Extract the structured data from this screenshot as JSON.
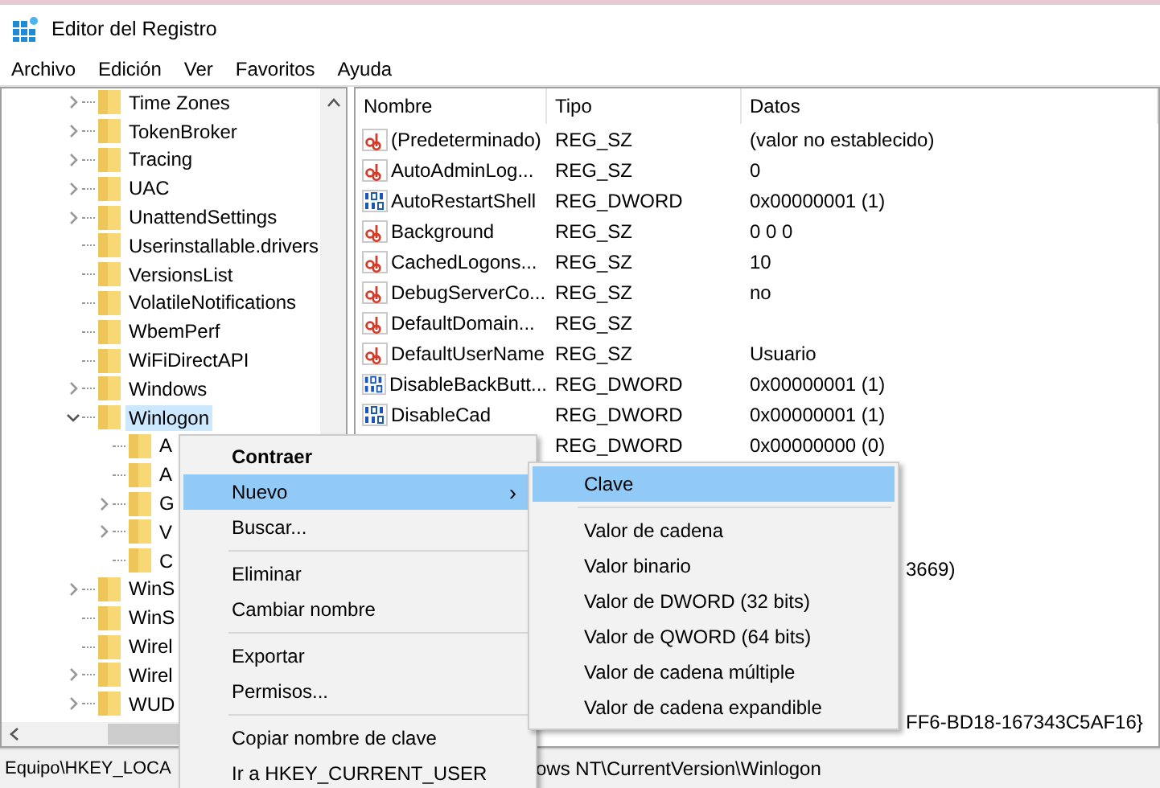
{
  "window": {
    "title": "Editor del Registro"
  },
  "menu_bar": [
    "Archivo",
    "Edición",
    "Ver",
    "Favoritos",
    "Ayuda"
  ],
  "tree": [
    {
      "label": "Time Zones",
      "expandable": true,
      "expanded": false,
      "selected": false
    },
    {
      "label": "TokenBroker",
      "expandable": true,
      "expanded": false,
      "selected": false
    },
    {
      "label": "Tracing",
      "expandable": true,
      "expanded": false,
      "selected": false
    },
    {
      "label": "UAC",
      "expandable": true,
      "expanded": false,
      "selected": false
    },
    {
      "label": "UnattendSettings",
      "expandable": true,
      "expanded": false,
      "selected": false
    },
    {
      "label": "Userinstallable.drivers",
      "expandable": false,
      "selected": false
    },
    {
      "label": "VersionsList",
      "expandable": false,
      "selected": false
    },
    {
      "label": "VolatileNotifications",
      "expandable": false,
      "selected": false
    },
    {
      "label": "WbemPerf",
      "expandable": false,
      "selected": false
    },
    {
      "label": "WiFiDirectAPI",
      "expandable": false,
      "selected": false
    },
    {
      "label": "Windows",
      "expandable": true,
      "expanded": false,
      "selected": false
    },
    {
      "label": "Winlogon",
      "expandable": true,
      "expanded": true,
      "selected": true,
      "children": [
        {
          "label": "A",
          "expandable": false,
          "selected": false
        },
        {
          "label": "A",
          "expandable": false,
          "selected": false
        },
        {
          "label": "G",
          "expandable": true,
          "expanded": false,
          "selected": false
        },
        {
          "label": "V",
          "expandable": true,
          "expanded": false,
          "selected": false
        },
        {
          "label": "C",
          "expandable": false,
          "selected": false
        }
      ]
    },
    {
      "label": "WinS",
      "expandable": true,
      "expanded": false,
      "selected": false
    },
    {
      "label": "WinS",
      "expandable": false,
      "selected": false
    },
    {
      "label": "Wirel",
      "expandable": false,
      "selected": false
    },
    {
      "label": "Wirel",
      "expandable": true,
      "expanded": false,
      "selected": false
    },
    {
      "label": "WUD",
      "expandable": true,
      "expanded": false,
      "selected": false
    }
  ],
  "list": {
    "columns": [
      "Nombre",
      "Tipo",
      "Datos"
    ],
    "rows": [
      {
        "kind": "sz",
        "name": "(Predeterminado)",
        "type": "REG_SZ",
        "data": "(valor no establecido)"
      },
      {
        "kind": "sz",
        "name": "AutoAdminLog...",
        "type": "REG_SZ",
        "data": "0"
      },
      {
        "kind": "dword",
        "name": "AutoRestartShell",
        "type": "REG_DWORD",
        "data": "0x00000001 (1)"
      },
      {
        "kind": "sz",
        "name": "Background",
        "type": "REG_SZ",
        "data": "0 0 0"
      },
      {
        "kind": "sz",
        "name": "CachedLogons...",
        "type": "REG_SZ",
        "data": "10"
      },
      {
        "kind": "sz",
        "name": "DebugServerCo...",
        "type": "REG_SZ",
        "data": "no"
      },
      {
        "kind": "sz",
        "name": "DefaultDomain...",
        "type": "REG_SZ"
      },
      {
        "kind": "sz",
        "name": "DefaultUserName",
        "type": "REG_SZ",
        "data": "Usuario"
      },
      {
        "kind": "dword",
        "name": "DisableBackButt...",
        "type": "REG_DWORD",
        "data": "0x00000001 (1)"
      },
      {
        "kind": "dword",
        "name": "DisableCad",
        "type": "REG_DWORD",
        "data": "0x00000001 (1)"
      },
      {
        "kind": "covered",
        "type": "REG_DWORD",
        "data": "0x00000000 (0)"
      },
      {
        "kind": "covered"
      },
      {
        "kind": "covered"
      },
      {
        "kind": "covered"
      },
      {
        "kind": "partial",
        "data": "3669)"
      },
      {
        "kind": "covered"
      },
      {
        "kind": "covered"
      },
      {
        "kind": "covered"
      },
      {
        "kind": "covered"
      },
      {
        "kind": "partial",
        "data": "FF6-BD18-167343C5AF16}"
      }
    ]
  },
  "context_menu": {
    "items": [
      {
        "kind": "item",
        "label": "Contraer",
        "bold": true,
        "selected": false
      },
      {
        "kind": "submenu",
        "label": "Nuevo",
        "bold": false,
        "selected": true,
        "arrow": "›"
      },
      {
        "kind": "item",
        "label": "Buscar...",
        "bold": false,
        "selected": false
      },
      {
        "kind": "separator"
      },
      {
        "kind": "item",
        "label": "Eliminar",
        "bold": false,
        "selected": false
      },
      {
        "kind": "item",
        "label": "Cambiar nombre",
        "bold": false,
        "selected": false
      },
      {
        "kind": "separator"
      },
      {
        "kind": "item",
        "label": "Exportar",
        "bold": false,
        "selected": false
      },
      {
        "kind": "item",
        "label": "Permisos...",
        "bold": false,
        "selected": false
      },
      {
        "kind": "separator"
      },
      {
        "kind": "item",
        "label": "Copiar nombre de clave",
        "bold": false,
        "selected": false
      },
      {
        "kind": "item",
        "label": "Ir a HKEY_CURRENT_USER",
        "bold": false,
        "selected": false
      }
    ]
  },
  "submenu": {
    "items": [
      {
        "kind": "item",
        "label": "Clave",
        "selected": true
      },
      {
        "kind": "separator"
      },
      {
        "kind": "item",
        "label": "Valor de cadena",
        "selected": false
      },
      {
        "kind": "item",
        "label": "Valor binario",
        "selected": false
      },
      {
        "kind": "item",
        "label": "Valor de DWORD (32 bits)",
        "selected": false
      },
      {
        "kind": "item",
        "label": "Valor de QWORD (64 bits)",
        "selected": false
      },
      {
        "kind": "item",
        "label": "Valor de cadena múltiple",
        "selected": false
      },
      {
        "kind": "item",
        "label": "Valor de cadena expandible",
        "selected": false
      }
    ]
  },
  "status_bar": [
    "Equipo\\HKEY_LOCA",
    "ows NT\\CurrentVersion\\Winlogon"
  ]
}
